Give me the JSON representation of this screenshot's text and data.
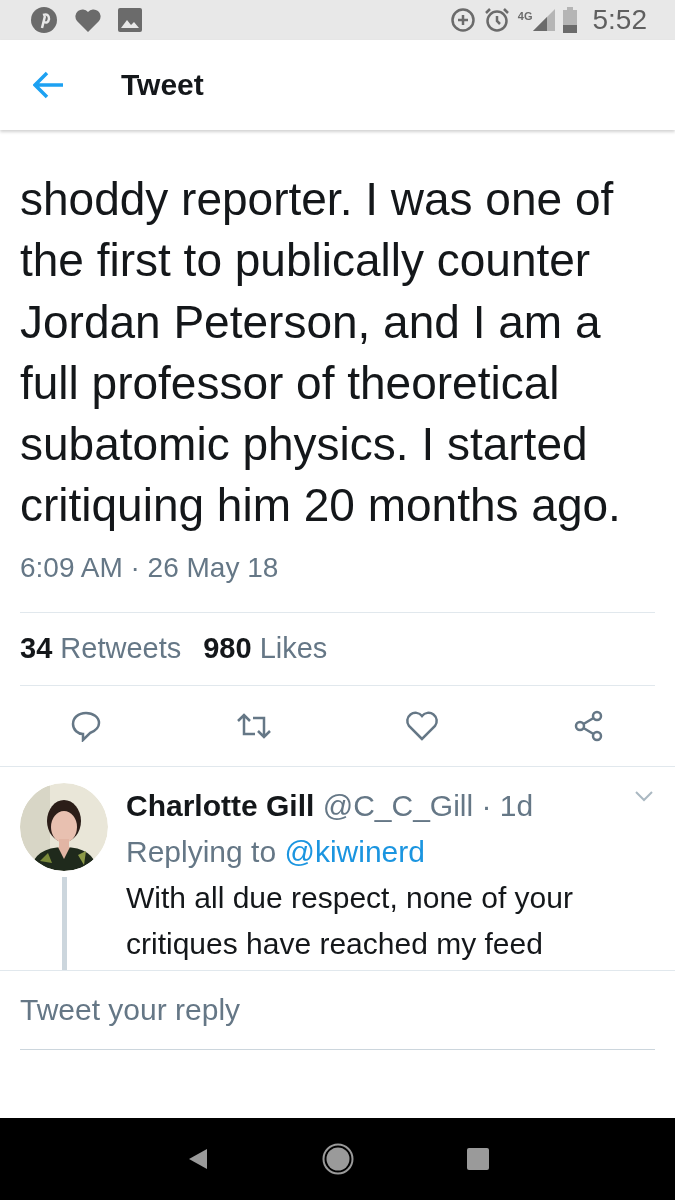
{
  "status_bar": {
    "time": "5:52",
    "network": "4G"
  },
  "header": {
    "title": "Tweet"
  },
  "tweet": {
    "text": "shoddy reporter. I was one of the first to publically counter Jordan Peterson, and I am a full professor of theoretical subatomic physics. I started critiquing him 20 months ago.",
    "timestamp": "6:09 AM · 26 May 18"
  },
  "stats": [
    {
      "count": "34",
      "label": "Retweets"
    },
    {
      "count": "980",
      "label": "Likes"
    }
  ],
  "reply": {
    "name": "Charlotte Gill",
    "handle": "@C_C_Gill",
    "age": "· 1d",
    "replying_label": "Replying to",
    "replying_to": "@kiwinerd",
    "text": "With all due respect, none of your critiques have reached my feed"
  },
  "composer": {
    "placeholder": "Tweet your reply"
  }
}
